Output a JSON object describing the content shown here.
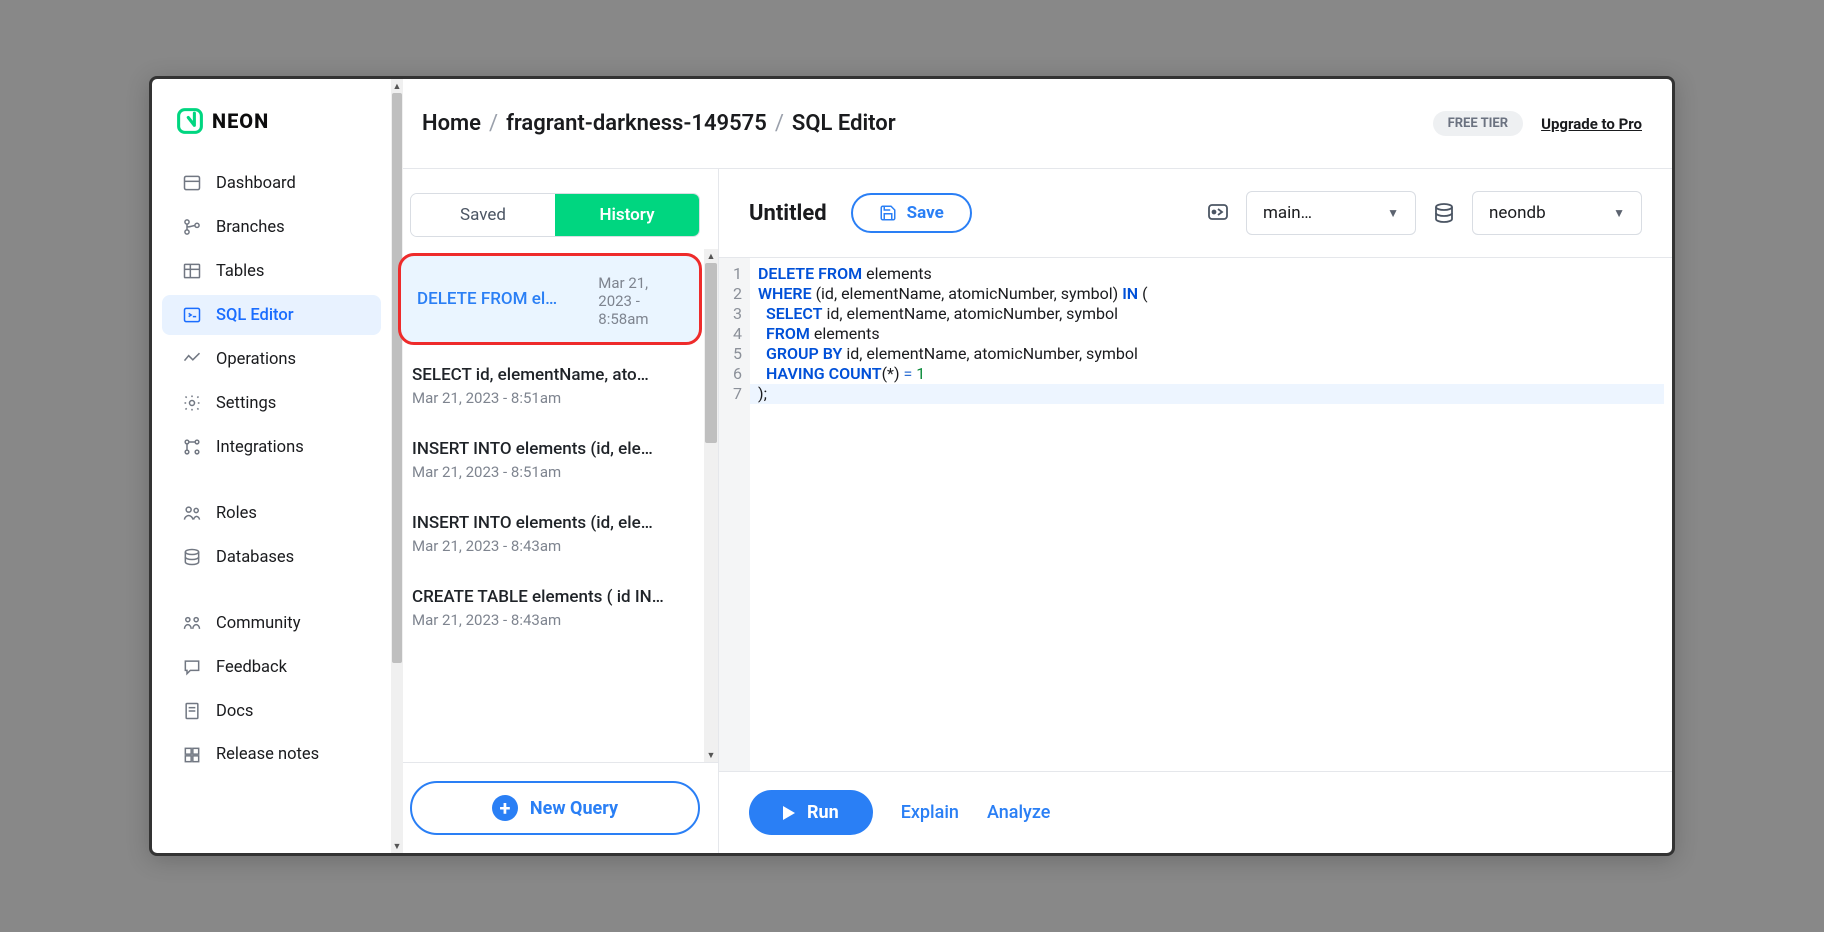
{
  "brand": "NEON",
  "nav": {
    "dashboard": "Dashboard",
    "branches": "Branches",
    "tables": "Tables",
    "sql_editor": "SQL Editor",
    "operations": "Operations",
    "settings": "Settings",
    "integrations": "Integrations",
    "roles": "Roles",
    "databases": "Databases",
    "community": "Community",
    "feedback": "Feedback",
    "docs": "Docs",
    "release_notes": "Release notes"
  },
  "breadcrumbs": {
    "home": "Home",
    "project": "fragrant-darkness-149575",
    "page": "SQL Editor"
  },
  "top": {
    "tier": "FREE TIER",
    "upgrade": "Upgrade to Pro"
  },
  "tabs": {
    "saved": "Saved",
    "history": "History"
  },
  "history": [
    {
      "q": "DELETE FROM elements WHER…",
      "d": "Mar 21, 2023 - 8:58am"
    },
    {
      "q": "SELECT id, elementName, ato…",
      "d": "Mar 21, 2023 - 8:51am"
    },
    {
      "q": "INSERT INTO elements (id, ele…",
      "d": "Mar 21, 2023 - 8:51am"
    },
    {
      "q": "INSERT INTO elements (id, ele…",
      "d": "Mar 21, 2023 - 8:43am"
    },
    {
      "q": "CREATE TABLE elements ( id IN…",
      "d": "Mar 21, 2023 - 8:43am"
    }
  ],
  "new_query": "New Query",
  "editor": {
    "title": "Untitled",
    "save": "Save",
    "branch": "main…",
    "database": "neondb"
  },
  "code": {
    "lines": [
      "1",
      "2",
      "3",
      "4",
      "5",
      "6",
      "7"
    ],
    "l1a": "DELETE",
    "l1b": "FROM",
    "l1c": " elements",
    "l2a": "WHERE",
    "l2b": " (id, elementName, atomicNumber, symbol) ",
    "l2c": "IN",
    "l2d": " (",
    "l3a": "SELECT",
    "l3b": " id, elementName, atomicNumber, symbol",
    "l4a": "FROM",
    "l4b": " elements",
    "l5a": "GROUP",
    "l5b": "BY",
    "l5c": " id, elementName, atomicNumber, symbol",
    "l6a": "HAVING",
    "l6b": "COUNT",
    "l6c": "(*) ",
    "l6d": "=",
    "l6e": " 1",
    "l7": ");"
  },
  "footer": {
    "run": "Run",
    "explain": "Explain",
    "analyze": "Analyze"
  }
}
